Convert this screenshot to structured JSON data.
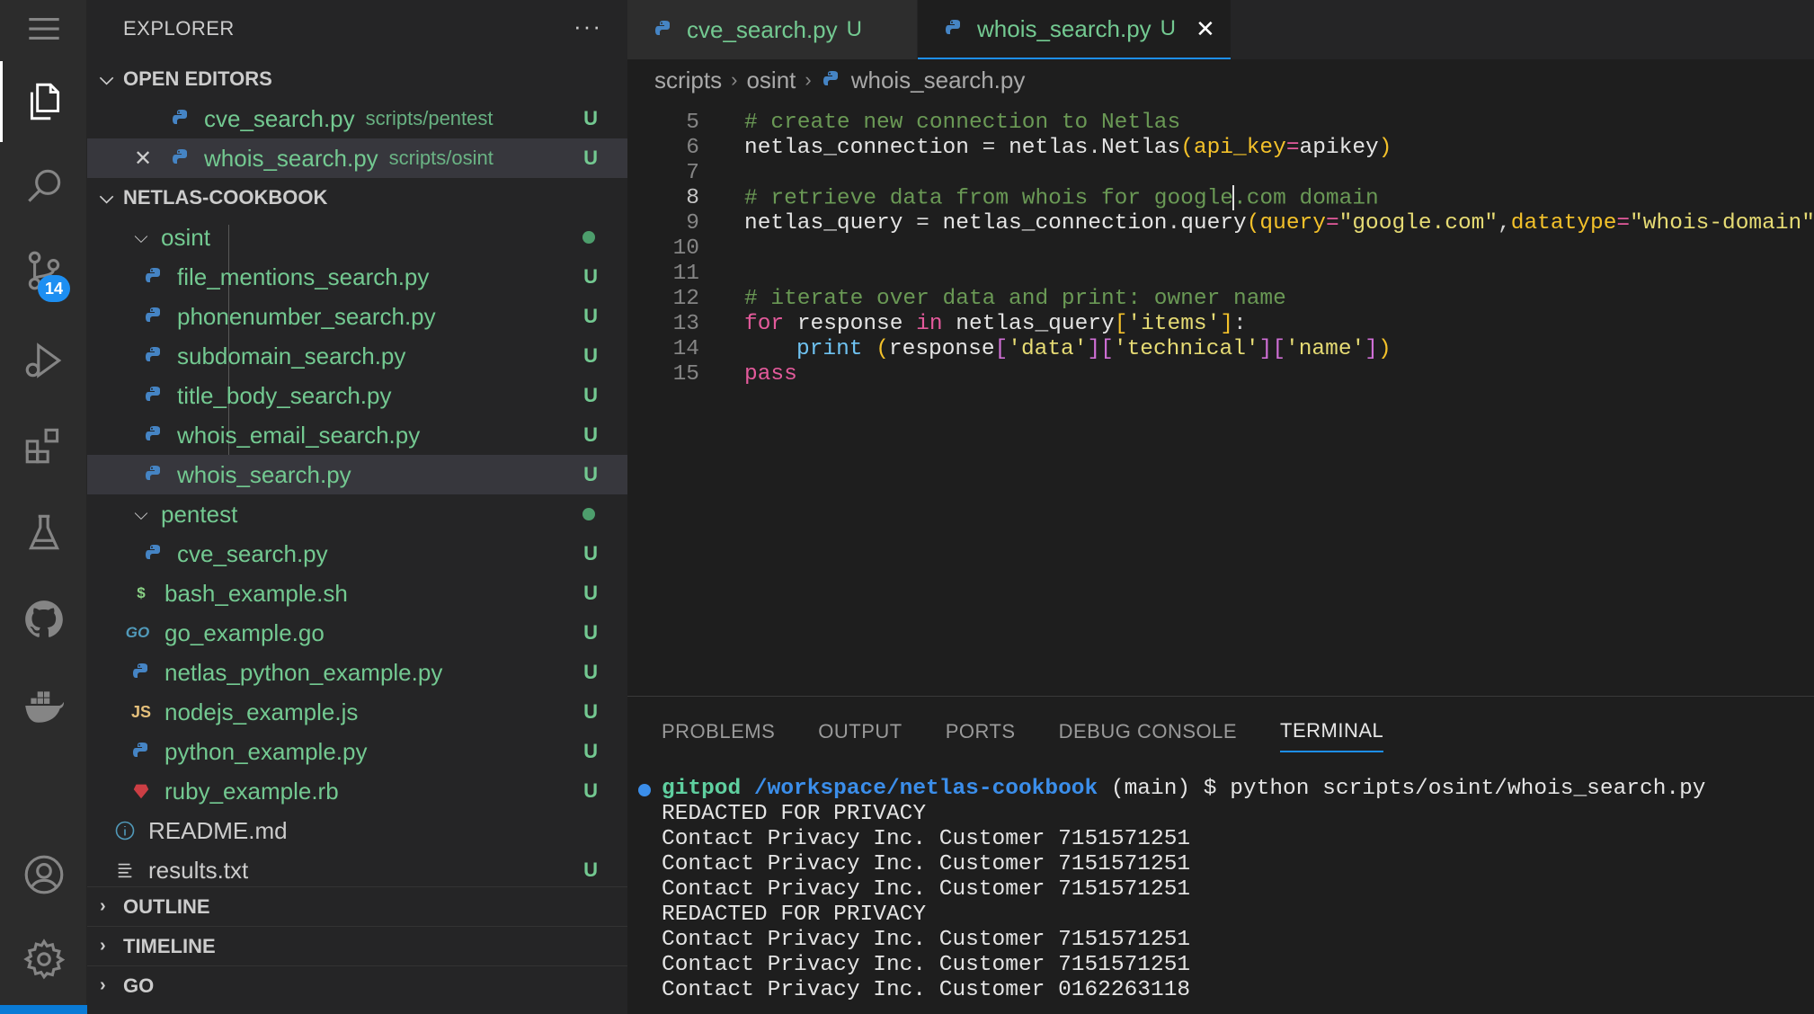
{
  "sidebar": {
    "title": "EXPLORER",
    "more": "···",
    "open_editors": {
      "label": "OPEN EDITORS",
      "items": [
        {
          "name": "cve_search.py",
          "desc": "scripts/pentest",
          "status": "U"
        },
        {
          "name": "whois_search.py",
          "desc": "scripts/osint",
          "status": "U"
        }
      ]
    },
    "workspace": {
      "label": "NETLAS-COOKBOOK",
      "folders": {
        "osint": "osint",
        "pentest": "pentest"
      },
      "osint_files": [
        {
          "name": "file_mentions_search.py",
          "status": "U"
        },
        {
          "name": "phonenumber_search.py",
          "status": "U"
        },
        {
          "name": "subdomain_search.py",
          "status": "U"
        },
        {
          "name": "title_body_search.py",
          "status": "U"
        },
        {
          "name": "whois_email_search.py",
          "status": "U"
        },
        {
          "name": "whois_search.py",
          "status": "U"
        }
      ],
      "pentest_files": [
        {
          "name": "cve_search.py",
          "status": "U"
        }
      ],
      "root_files": [
        {
          "name": "bash_example.sh",
          "status": "U",
          "icon": "$"
        },
        {
          "name": "go_example.go",
          "status": "U",
          "icon": "GO"
        },
        {
          "name": "netlas_python_example.py",
          "status": "U",
          "icon": "py"
        },
        {
          "name": "nodejs_example.js",
          "status": "U",
          "icon": "JS"
        },
        {
          "name": "python_example.py",
          "status": "U",
          "icon": "py"
        },
        {
          "name": "ruby_example.rb",
          "status": "U",
          "icon": "rb"
        },
        {
          "name": "README.md",
          "status": "",
          "icon": "info"
        },
        {
          "name": "results.txt",
          "status": "U",
          "icon": "txt"
        }
      ]
    },
    "bottom_sections": [
      "OUTLINE",
      "TIMELINE",
      "GO"
    ]
  },
  "activity_bar": {
    "scm_badge": "14",
    "icons": [
      "menu-icon",
      "files-icon",
      "search-icon",
      "source-control-icon",
      "run-debug-icon",
      "extensions-icon",
      "testing-icon",
      "github-icon",
      "docker-icon",
      "account-icon",
      "settings-gear-icon"
    ]
  },
  "tabs": [
    {
      "label": "cve_search.py",
      "status": "U",
      "active": false
    },
    {
      "label": "whois_search.py",
      "status": "U",
      "active": true,
      "close": "✕"
    }
  ],
  "breadcrumb": [
    "scripts",
    "osint",
    "whois_search.py"
  ],
  "code": {
    "lines": [
      "5",
      "6",
      "7",
      "8",
      "9",
      "10",
      "11",
      "12",
      "13",
      "14",
      "15"
    ],
    "comment_5": "# create new connection to Netlas",
    "l6_var": "netlas_connection",
    "l6_obj": "netlas",
    "l6_cls": "Netlas",
    "l6_param": "api_key",
    "l6_val": "apikey",
    "comment_8a": "# retrieve data from whois for google",
    "comment_8b": ".com domain",
    "l9_var": "netlas_query",
    "l9_obj": "netlas_connection",
    "l9_fn": "query",
    "l9_p1": "query",
    "l9_s1": "\"google.com\"",
    "l9_p2": "datatype",
    "l9_s2": "\"whois-domain\"",
    "comment_12": "# iterate over data and print: owner name",
    "l13_for": "for",
    "l13_var": "response",
    "l13_in": "in",
    "l13_obj": "netlas_query",
    "l13_key": "'items'",
    "l14_fn": "print",
    "l14_var": "response",
    "l14_k1": "'data'",
    "l14_k2": "'technical'",
    "l14_k3": "'name'",
    "l15_kw": "pass"
  },
  "panel": {
    "tabs": [
      "PROBLEMS",
      "OUTPUT",
      "PORTS",
      "DEBUG CONSOLE",
      "TERMINAL"
    ],
    "active_tab": "TERMINAL",
    "prompt_user": "gitpod",
    "prompt_path": "/workspace/netlas-cookbook",
    "prompt_rest": " (main) $ python scripts/osint/whois_search.py",
    "output": [
      "REDACTED FOR PRIVACY",
      "Contact Privacy Inc. Customer 7151571251",
      "Contact Privacy Inc. Customer 7151571251",
      "Contact Privacy Inc. Customer 7151571251",
      "REDACTED FOR PRIVACY",
      "Contact Privacy Inc. Customer 7151571251",
      "Contact Privacy Inc. Customer 7151571251",
      "Contact Privacy Inc. Customer 0162263118"
    ]
  },
  "colors": {
    "untracked": "#73c991",
    "accent": "#1d8ff2"
  }
}
